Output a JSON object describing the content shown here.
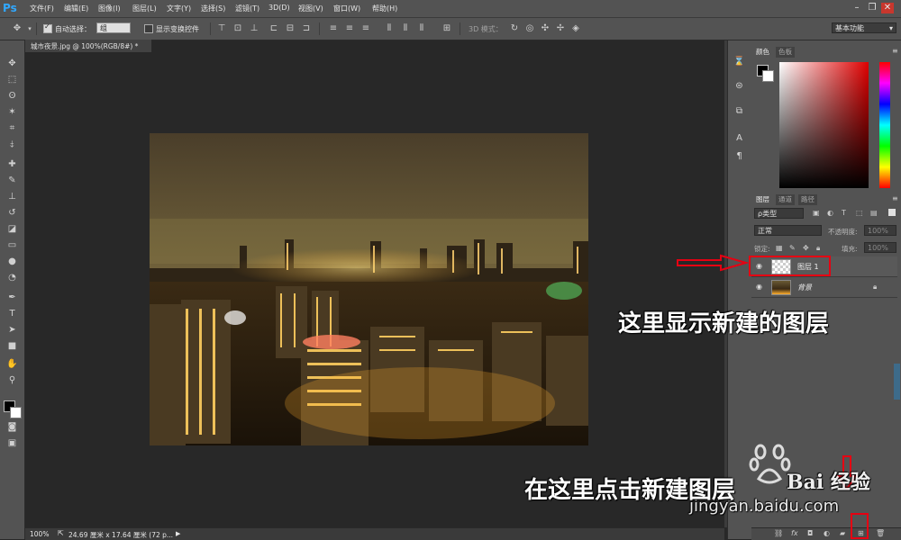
{
  "app": {
    "logo": "Ps"
  },
  "menu": [
    "文件(F)",
    "编辑(E)",
    "图像(I)",
    "图层(L)",
    "文字(Y)",
    "选择(S)",
    "滤镜(T)",
    "3D(D)",
    "视图(V)",
    "窗口(W)",
    "帮助(H)"
  ],
  "window_controls": [
    "–",
    "❐",
    "✕"
  ],
  "options": {
    "auto_select_label": "自动选择：",
    "auto_select_value": "组",
    "show_transform_label": "显示变换控件",
    "mode_3d_label": "3D 模式：",
    "workspace": "基本功能"
  },
  "document": {
    "tab_label": "城市夜景.jpg @ 100%(RGB/8#) *",
    "zoom": "100%",
    "doc_info": "24.69 厘米 x 17.64 厘米 (72 p..."
  },
  "color_panel": {
    "tabs": [
      "颜色",
      "色板"
    ]
  },
  "layers_panel": {
    "tabs": [
      "图层",
      "通道",
      "路径"
    ],
    "filter_kind": "ρ类型",
    "blend_mode": "正常",
    "opacity_label": "不透明度:",
    "opacity_value": "100%",
    "lock_label": "锁定:",
    "fill_label": "填充:",
    "fill_value": "100%",
    "layers": [
      {
        "name": "图层 1"
      },
      {
        "name": "背景"
      }
    ]
  },
  "annotations": {
    "layer_note": "这里显示新建的图层",
    "button_note": "在这里点击新建图层"
  },
  "watermark": {
    "brand": "Bai 经验",
    "url": "jingyan.baidu.com"
  },
  "colors": {
    "highlight": "#e60012",
    "ui_bg": "#535353",
    "canvas_bg": "#282828"
  }
}
